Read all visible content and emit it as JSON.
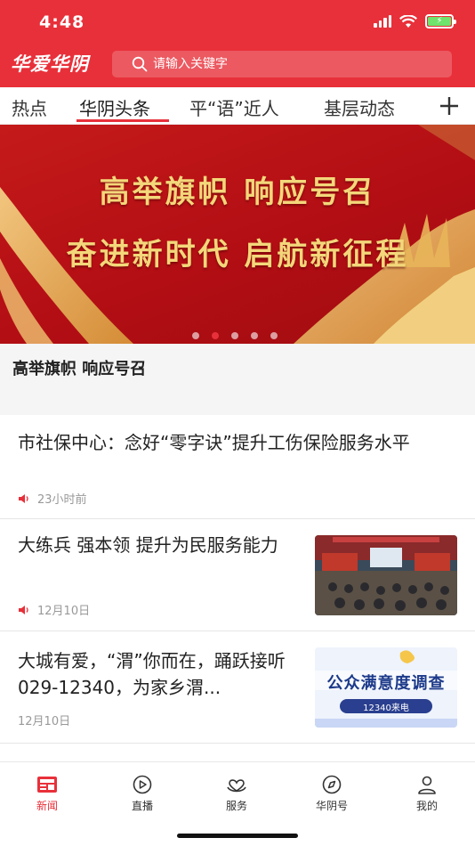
{
  "status_bar": {
    "time": "4:48"
  },
  "header": {
    "logo": "华爱华阴",
    "search_placeholder": "请输入关键字"
  },
  "tabs": [
    {
      "label": "热点",
      "active": false
    },
    {
      "label": "华阴头条",
      "active": true
    },
    {
      "label": "平“语”近人",
      "active": false
    },
    {
      "label": "基层动态",
      "active": false
    }
  ],
  "banner": {
    "line1": "高举旗帜 响应号召",
    "line2": "奋进新时代 启航新征程",
    "caption": "高举旗帜  响应号召",
    "dot_count": 5,
    "active_dot": 1
  },
  "news": [
    {
      "title": "市社保中心：念好“零字诀”提升工伤保险服务水平",
      "time": "23小时前",
      "audio": true,
      "thumb": null
    },
    {
      "title": "大练兵 强本领  提升为民服务能力",
      "time": "12月10日",
      "audio": true,
      "thumb": "meeting-photo"
    },
    {
      "title": "大城有爱，“渭”你而在，踊跃接听029-12340，为家乡渭...",
      "time": "12月10日",
      "audio": false,
      "thumb": "survey-poster",
      "thumb_text": {
        "main": "公众满意度调查",
        "sub": "12340来电"
      }
    }
  ],
  "bottom_nav": [
    {
      "label": "新闻",
      "icon": "news-icon",
      "active": true
    },
    {
      "label": "直播",
      "icon": "live-icon",
      "active": false
    },
    {
      "label": "服务",
      "icon": "service-icon",
      "active": false
    },
    {
      "label": "华阴号",
      "icon": "compass-icon",
      "active": false
    },
    {
      "label": "我的",
      "icon": "profile-icon",
      "active": false
    }
  ],
  "colors": {
    "brand": "#e8303a",
    "banner_text": "#f3d77a"
  }
}
